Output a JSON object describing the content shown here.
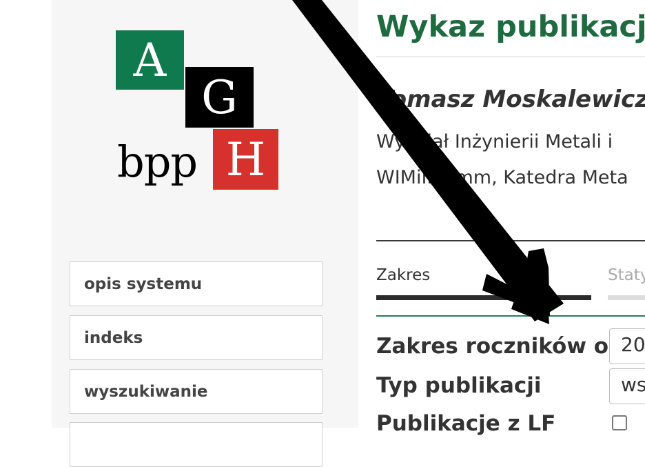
{
  "logo": {
    "letter_a": "A",
    "letter_g": "G",
    "letter_h": "H",
    "wordmark": "bpp"
  },
  "sidebar": {
    "items": [
      {
        "label": "opis systemu"
      },
      {
        "label": "indeks"
      },
      {
        "label": "wyszukiwanie"
      },
      {
        "label": ""
      }
    ]
  },
  "main": {
    "title": "Wykaz publikacji",
    "author": "Tomasz Moskalewicz",
    "unit_line_1": "Wydział Inżynierii Metali i",
    "unit_line_2": "WIMiIP-kmm, Katedra Meta",
    "tabs": [
      {
        "label": "Zakres",
        "active": true
      },
      {
        "label": "Staty",
        "active": false
      }
    ],
    "form": {
      "year_range_label": "Zakres roczników od",
      "year_from_value": "20",
      "pub_type_label": "Typ publikacji",
      "pub_type_value": "ws",
      "lf_label": "Publikacje z LF"
    }
  },
  "colors": {
    "logo_green": "#0f7a4e",
    "logo_black": "#000000",
    "logo_red": "#d6312d",
    "title_green": "#1e6b40",
    "rule_green": "#2d7a55"
  }
}
